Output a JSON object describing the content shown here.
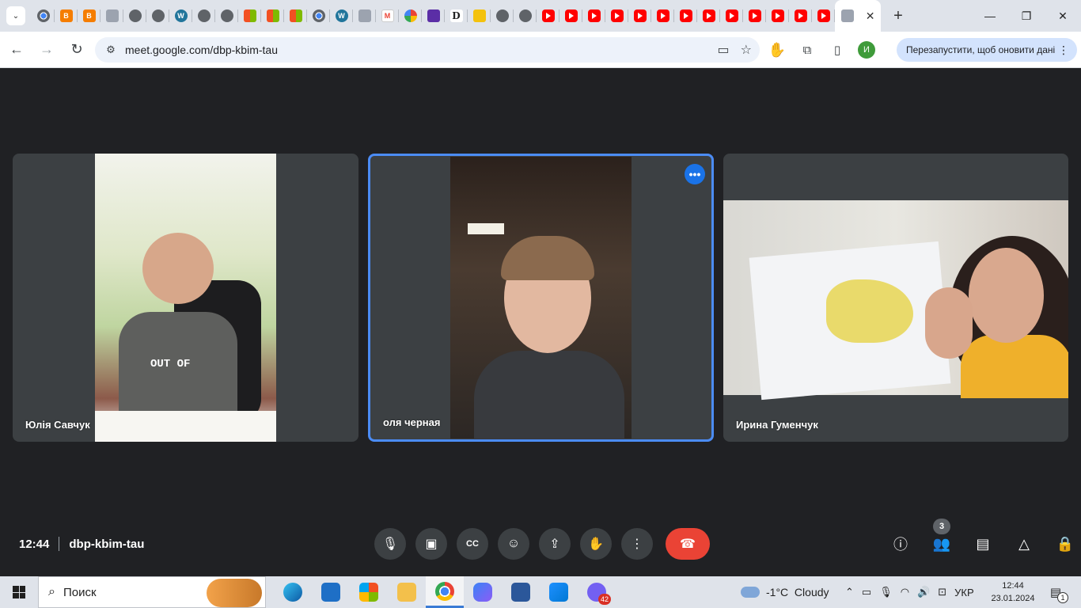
{
  "browser": {
    "tabs": [
      {
        "icon": "chrome-icon",
        "cls": "chrome"
      },
      {
        "icon": "blogger-icon",
        "cls": "blogger",
        "glyph": "B"
      },
      {
        "icon": "blogger-icon",
        "cls": "blogger",
        "glyph": "B"
      },
      {
        "icon": "shield-icon",
        "cls": "misc"
      },
      {
        "icon": "globe-icon",
        "cls": "globe"
      },
      {
        "icon": "globe-icon",
        "cls": "globe"
      },
      {
        "icon": "wordpress-icon",
        "cls": "wp",
        "glyph": "W"
      },
      {
        "icon": "globe-icon",
        "cls": "globe"
      },
      {
        "icon": "globe-icon",
        "cls": "globe"
      },
      {
        "icon": "microsoft-icon",
        "cls": "ms"
      },
      {
        "icon": "microsoft-icon",
        "cls": "ms"
      },
      {
        "icon": "microsoft-icon",
        "cls": "ms"
      },
      {
        "icon": "chrome-icon",
        "cls": "chrome"
      },
      {
        "icon": "wordpress-icon",
        "cls": "wp",
        "glyph": "W"
      },
      {
        "icon": "puzzle-icon",
        "cls": "misc"
      },
      {
        "icon": "gmail-icon",
        "cls": "gmail",
        "glyph": "M"
      },
      {
        "icon": "photos-icon",
        "cls": "photos"
      },
      {
        "icon": "list-icon",
        "cls": "purple"
      },
      {
        "icon": "d-icon",
        "cls": "d",
        "glyph": "D"
      },
      {
        "icon": "cone-icon",
        "cls": "yellow"
      },
      {
        "icon": "globe-icon",
        "cls": "globe"
      },
      {
        "icon": "globe-icon",
        "cls": "globe"
      },
      {
        "icon": "youtube-icon",
        "cls": "yt"
      },
      {
        "icon": "youtube-icon",
        "cls": "yt"
      },
      {
        "icon": "youtube-icon",
        "cls": "yt"
      },
      {
        "icon": "youtube-icon",
        "cls": "yt"
      },
      {
        "icon": "youtube-icon",
        "cls": "yt"
      },
      {
        "icon": "youtube-icon",
        "cls": "yt"
      },
      {
        "icon": "youtube-icon",
        "cls": "yt"
      },
      {
        "icon": "youtube-icon",
        "cls": "yt"
      },
      {
        "icon": "youtube-icon",
        "cls": "yt"
      },
      {
        "icon": "youtube-icon",
        "cls": "yt"
      },
      {
        "icon": "youtube-icon",
        "cls": "yt"
      },
      {
        "icon": "youtube-icon",
        "cls": "yt"
      },
      {
        "icon": "youtube-icon",
        "cls": "yt"
      }
    ],
    "url": "meet.google.com/dbp-kbim-tau",
    "avatar_initial": "И",
    "restart_label": "Перезапустити, щоб оновити дані"
  },
  "meeting": {
    "time": "12:44",
    "code": "dbp-kbim-tau",
    "participant_count": "3",
    "participants": [
      {
        "name": "Юлія Савчук"
      },
      {
        "name": "оля черная"
      },
      {
        "name": "Ирина Гуменчук"
      }
    ],
    "shirt_text": "OUT OF"
  },
  "taskbar": {
    "search_placeholder": "Поиск",
    "viber_badge": "42",
    "weather": "-1°C  Cloudy",
    "lang": "УКР",
    "clock_time": "12:44",
    "clock_date": "23.01.2024",
    "notif_count": "1"
  },
  "colors": {
    "meet_bg": "#202124",
    "tile_bg": "#3c4043",
    "active_border": "#4b8cf5",
    "hangup": "#ea4335"
  }
}
